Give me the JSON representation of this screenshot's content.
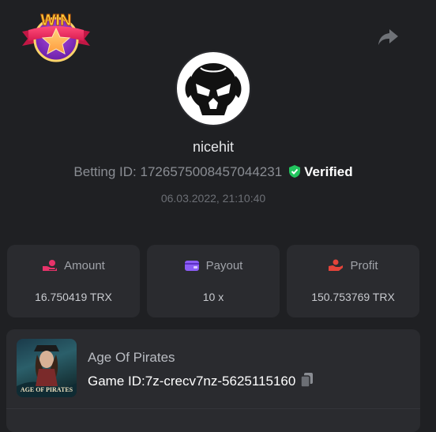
{
  "badge": {
    "text": "WIN"
  },
  "user": {
    "name": "nicehit"
  },
  "bet": {
    "betting_label": "Betting ID:",
    "betting_id": "1726575008457044231",
    "verified_label": "Verified",
    "datetime": "06.03.2022, 21:10:40"
  },
  "stats": [
    {
      "label": "Amount",
      "value": "16.750419 TRX",
      "icon": "coins-hand-icon",
      "color": "#e8336a"
    },
    {
      "label": "Payout",
      "value": "10 x",
      "icon": "wallet-icon",
      "color": "#8b5cf6"
    },
    {
      "label": "Profit",
      "value": "150.753769 TRX",
      "icon": "profit-hand-icon",
      "color": "#e5443a"
    }
  ],
  "game": {
    "name": "Age Of Pirates",
    "id_label": "Game ID:",
    "id_value": "7z-crecv7nz-5625115160",
    "thumb_text": "AGE OF PIRATES"
  },
  "colors": {
    "background": "#1f2023",
    "card": "#2a2b2f",
    "verified_green": "#22c55e"
  }
}
